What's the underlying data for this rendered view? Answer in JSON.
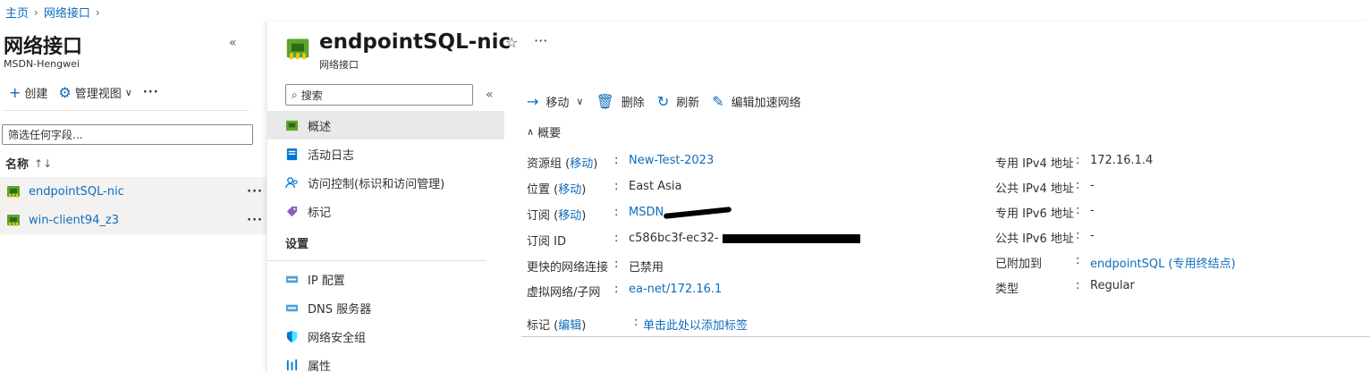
{
  "breadcrumb": {
    "home": "主页",
    "current": "网络接口"
  },
  "left": {
    "title": "网络接口",
    "subtitle": "MSDN-Hengwei",
    "toolbar": {
      "create": "创建",
      "manage_view": "管理视图"
    },
    "filter_placeholder": "筛选任何字段...",
    "column_name": "名称",
    "items": [
      {
        "name": "endpointSQL-nic"
      },
      {
        "name": "win-client94_z3"
      }
    ]
  },
  "resource": {
    "title": "endpointSQL-nic",
    "subtitle": "网络接口",
    "search_placeholder": "搜索",
    "nav": {
      "overview": "概述",
      "activity_log": "活动日志",
      "iam": "访问控制(标识和访问管理)",
      "tags": "标记",
      "settings_header": "设置",
      "ip_config": "IP 配置",
      "dns": "DNS 服务器",
      "nsg": "网络安全组",
      "properties": "属性"
    },
    "commands": {
      "move": "移动",
      "delete": "删除",
      "refresh": "刷新",
      "accel": "编辑加速网络"
    },
    "essentials_label": "概要",
    "essentials_left": [
      {
        "label": "资源组",
        "link": "移动",
        "value": "New-Test-2023",
        "value_is_link": true
      },
      {
        "label": "位置",
        "link": "移动",
        "value": "East Asia",
        "value_is_link": false
      },
      {
        "label": "订阅",
        "link": "移动",
        "value": "MSDN",
        "value_is_link": true
      },
      {
        "label": "订阅 ID",
        "link": "",
        "value": "c586bc3f-ec32-",
        "value_is_link": false
      },
      {
        "label": "更快的网络连接",
        "link": "",
        "value": "已禁用",
        "value_is_link": false
      },
      {
        "label": "虚拟网络/子网",
        "link": "",
        "value": "ea-net/172.16.1",
        "value_is_link": true
      }
    ],
    "essentials_right": [
      {
        "label": "专用 IPv4 地址",
        "value": "172.16.1.4",
        "value_is_link": false
      },
      {
        "label": "公共 IPv4 地址",
        "value": "-",
        "value_is_link": false
      },
      {
        "label": "专用 IPv6 地址",
        "value": "-",
        "value_is_link": false
      },
      {
        "label": "公共 IPv6 地址",
        "value": "-",
        "value_is_link": false
      },
      {
        "label": "已附加到",
        "value": "endpointSQL (专用终结点)",
        "value_is_link": true
      },
      {
        "label": "类型",
        "value": "Regular",
        "value_is_link": false
      }
    ],
    "tags_row": {
      "label": "标记",
      "link": "编辑",
      "value": "单击此处以添加标签"
    }
  },
  "colors": {
    "link": "#0f6cbd",
    "nic_green": "#5ea32b"
  }
}
